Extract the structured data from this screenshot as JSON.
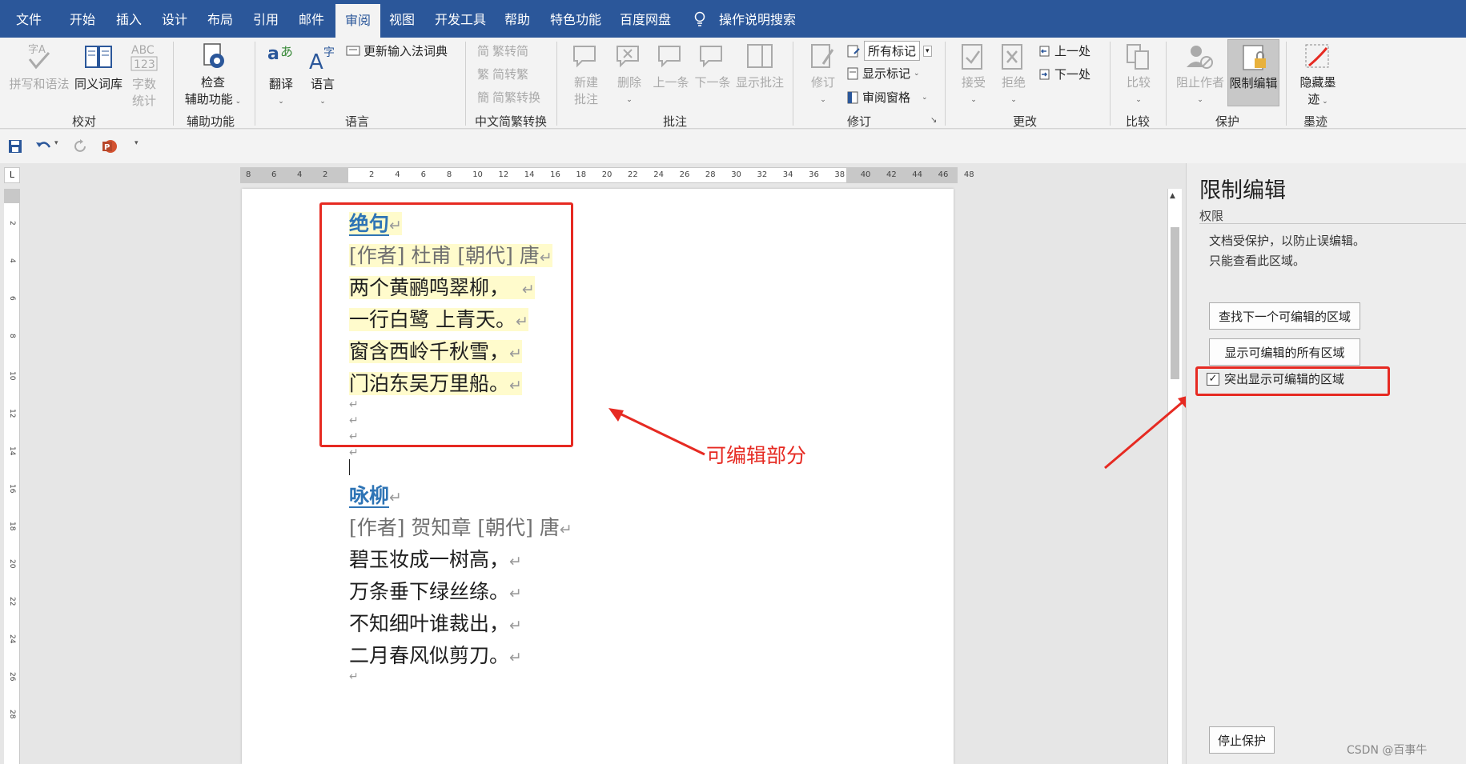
{
  "menubar": {
    "tabs": [
      {
        "label": "文件",
        "active": false
      },
      {
        "label": "开始",
        "active": false
      },
      {
        "label": "插入",
        "active": false
      },
      {
        "label": "设计",
        "active": false
      },
      {
        "label": "布局",
        "active": false
      },
      {
        "label": "引用",
        "active": false
      },
      {
        "label": "邮件",
        "active": false
      },
      {
        "label": "审阅",
        "active": true
      },
      {
        "label": "视图",
        "active": false
      },
      {
        "label": "开发工具",
        "active": false
      },
      {
        "label": "帮助",
        "active": false
      },
      {
        "label": "特色功能",
        "active": false
      },
      {
        "label": "百度网盘",
        "active": false
      }
    ],
    "search_label": "操作说明搜索"
  },
  "ribbon": {
    "proofing": {
      "label": "校对",
      "spell": "拼写和语法",
      "thesaurus": "同义词库",
      "wordcount1": "字数",
      "wordcount2": "统计"
    },
    "accessibility": {
      "label": "辅助功能",
      "check1": "检查",
      "check2": "辅助功能"
    },
    "language": {
      "label": "语言",
      "translate": "翻译",
      "language": "语言",
      "ime": "更新输入法词典"
    },
    "chinese": {
      "label": "中文简繁转换",
      "t2s": "繁转简",
      "s2t": "简转繁",
      "convert": "简繁转换"
    },
    "comments": {
      "label": "批注",
      "new1": "新建",
      "new2": "批注",
      "delete": "删除",
      "prev": "上一条",
      "next": "下一条",
      "show": "显示批注"
    },
    "tracking": {
      "label": "修订",
      "track": "修订",
      "markup_select": "所有标记",
      "show_markup": "显示标记",
      "review_pane": "审阅窗格"
    },
    "changes": {
      "label": "更改",
      "accept": "接受",
      "reject": "拒绝",
      "prev": "上一处",
      "next": "下一处"
    },
    "compare": {
      "label": "比较",
      "compare": "比较"
    },
    "protect": {
      "label": "保护",
      "block": "阻止作者",
      "restrict": "限制编辑"
    },
    "ink": {
      "label": "墨迹",
      "hide1": "隐藏墨",
      "hide2": "迹"
    }
  },
  "ruler": {
    "h_ticks": [
      "8",
      "6",
      "4",
      "2",
      "2",
      "4",
      "6",
      "8",
      "10",
      "12",
      "14",
      "16",
      "18",
      "20",
      "22",
      "24",
      "26",
      "28",
      "30",
      "32",
      "34",
      "36",
      "38",
      "40",
      "42",
      "44",
      "46",
      "48"
    ],
    "v_ticks": [
      "2",
      "4",
      "6",
      "8",
      "10",
      "12",
      "14",
      "16",
      "18",
      "20",
      "22",
      "24",
      "26",
      "28"
    ]
  },
  "document": {
    "poem1": {
      "title": "绝句",
      "author": "[作者] 杜甫 [朝代] 唐",
      "lines": [
        "两个黄鹂鸣翠柳，",
        "一行白鹭 上青天。",
        "窗含西岭千秋雪，",
        "门泊东吴万里船。"
      ]
    },
    "poem2": {
      "title": "咏柳",
      "author": "[作者] 贺知章 [朝代] 唐",
      "lines": [
        "碧玉妆成一树高，",
        "万条垂下绿丝绦。",
        "不知细叶谁裁出，",
        "二月春风似剪刀。"
      ]
    },
    "para_mark": "↵",
    "annotation": "可编辑部分"
  },
  "pane": {
    "title": "限制编辑",
    "section": "权限",
    "info1": "文档受保护，以防止误编辑。",
    "info2": "只能查看此区域。",
    "find_next": "查找下一个可编辑的区域",
    "show_all": "显示可编辑的所有区域",
    "highlight": "突出显示可编辑的区域",
    "highlight_checked": true,
    "stop": "停止保护"
  },
  "watermark": "CSDN @百事牛",
  "colors": {
    "brand": "#2b579a",
    "annotation": "#e62a22",
    "highlight": "#fffbcc",
    "title": "#2e74b5"
  }
}
